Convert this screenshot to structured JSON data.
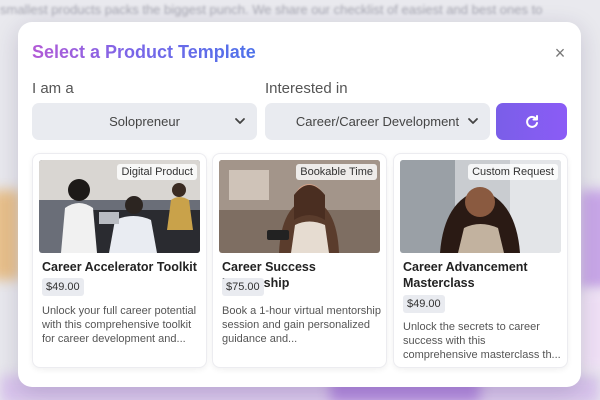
{
  "background": {
    "text": "smallest products packs the biggest punch. We share our checklist of easiest and best ones to"
  },
  "modal": {
    "title": "Select a Product Template",
    "close_label": "×",
    "filters": {
      "iam_label": "I am a",
      "iam_value": "Solopreneur",
      "interest_label": "Interested in",
      "interest_value": "Career/Career Development"
    },
    "cards": [
      {
        "badge": "Digital Product",
        "title": "Career Accelerator Toolkit",
        "price": "$49.00",
        "description": "Unlock your full career potential with this comprehensive toolkit for career development and..."
      },
      {
        "badge": "Bookable Time",
        "title": "Career Success Mentorship",
        "price": "$75.00",
        "description": "Book a 1-hour virtual mentorship session and gain personalized guidance and..."
      },
      {
        "badge": "Custom Request",
        "title": "Career Advancement Masterclass",
        "price": "$49.00",
        "description": "Unlock the secrets to career success with this comprehensive masterclass th..."
      }
    ]
  },
  "colors": {
    "accent": "#8b5cf6",
    "title_gradient_start": "#b35ad6",
    "title_gradient_end": "#4d72ea",
    "field_bg": "#e9ebf0"
  },
  "icons": {
    "close": "close-icon",
    "chevron": "chevron-down-icon",
    "refresh": "refresh-icon"
  }
}
